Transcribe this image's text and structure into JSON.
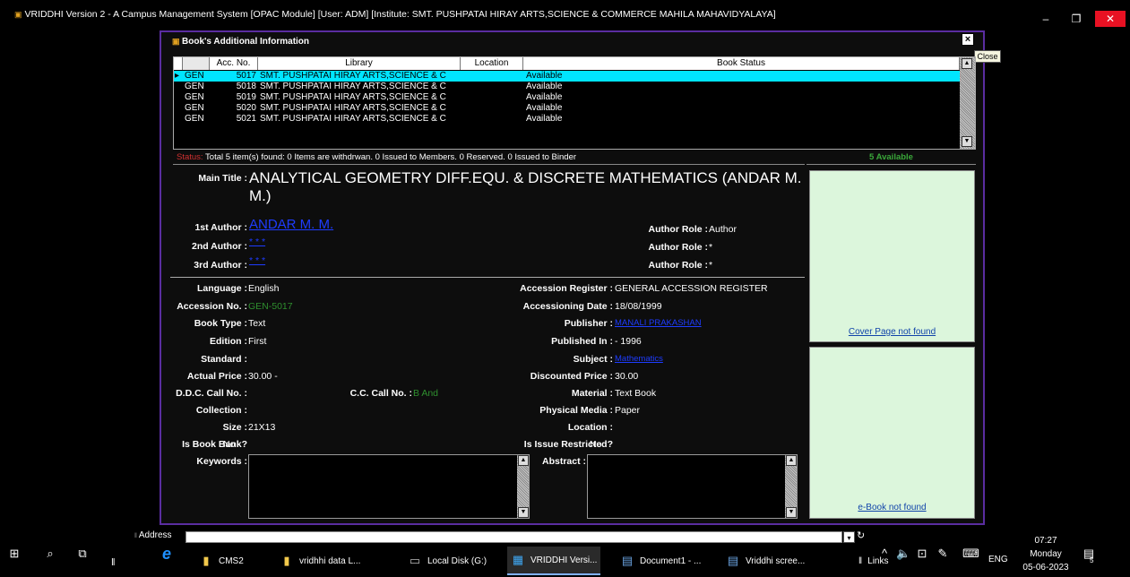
{
  "window": {
    "title": "VRIDDHI Version 2 - A Campus Management System [OPAC Module] [User: ADM] [Institute: SMT. PUSHPATAI HIRAY ARTS,SCIENCE & COMMERCE MAHILA MAHAVIDYALAYA]",
    "controls": {
      "minimize": "–",
      "restore": "❐",
      "close": "✕"
    }
  },
  "dialog": {
    "title": "Book's Additional Information",
    "close_glyph": "×",
    "close_tooltip": "Close"
  },
  "grid": {
    "columns": [
      "Acc. No.",
      "Library",
      "Location",
      "Book Status"
    ],
    "rows": [
      {
        "code": "GEN",
        "acc": "5017",
        "library": "SMT. PUSHPATAI HIRAY ARTS,SCIENCE & C",
        "location": "",
        "status": "Available",
        "selected": true
      },
      {
        "code": "GEN",
        "acc": "5018",
        "library": "SMT. PUSHPATAI HIRAY ARTS,SCIENCE & C",
        "location": "",
        "status": "Available"
      },
      {
        "code": "GEN",
        "acc": "5019",
        "library": "SMT. PUSHPATAI HIRAY ARTS,SCIENCE & C",
        "location": "",
        "status": "Available"
      },
      {
        "code": "GEN",
        "acc": "5020",
        "library": "SMT. PUSHPATAI HIRAY ARTS,SCIENCE & C",
        "location": "",
        "status": "Available"
      },
      {
        "code": "GEN",
        "acc": "5021",
        "library": "SMT. PUSHPATAI HIRAY ARTS,SCIENCE & C",
        "location": "",
        "status": "Available"
      }
    ]
  },
  "status": {
    "label": "Status:",
    "text": "Total 5 item(s) found:   0 Items are withdrwan.   0 Issued to Members.   0 Reserved.   0 Issued to Binder",
    "available": "5 Available"
  },
  "book": {
    "main_title_label": "Main Title :",
    "main_title": "ANALYTICAL GEOMETRY DIFF.EQU. & DISCRETE MATHEMATICS (ANDAR M. M.)",
    "author1_label": "1st Author :",
    "author1": "ANDAR M. M.",
    "author2_label": "2nd Author :",
    "author2": "* * *",
    "author3_label": "3rd Author :",
    "author3": "* * *",
    "role1_label": "Author Role :",
    "role1": "Author",
    "role2_label": "Author Role :",
    "role2": "*",
    "role3_label": "Author Role :",
    "role3": "*"
  },
  "details": {
    "language_label": "Language :",
    "language": "English",
    "accno_label": "Accession No. :",
    "accno": "GEN-5017",
    "booktype_label": "Book Type :",
    "booktype": "Text",
    "edition_label": "Edition :",
    "edition": "First",
    "standard_label": "Standard :",
    "standard": "",
    "price_label": "Actual Price :",
    "price": "30.00 -",
    "ddc_label": "D.D.C. Call No. :",
    "ddc": "",
    "cc_label": "C.C. Call No. :",
    "cc": "B And",
    "collection_label": "Collection :",
    "collection": "",
    "size_label": "Size :",
    "size": "21X13",
    "bookbank_label": "Is Book Bank?",
    "bookbank": "No",
    "keywords_label": "Keywords :",
    "register_label": "Accession Register :",
    "register": "GENERAL ACCESSION REGISTER",
    "accdate_label": "Accessioning Date :",
    "accdate": "18/08/1999",
    "publisher_label": "Publisher :",
    "publisher": "MANALI PRAKASHAN",
    "pubin_label": "Published In :",
    "pubin": "- 1996",
    "subject_label": "Subject :",
    "subject": "Mathematics",
    "discprice_label": "Discounted Price :",
    "discprice": "30.00",
    "material_label": "Material :",
    "material": "Text Book",
    "physical_label": "Physical Media :",
    "physical": "Paper",
    "location_label": "Location :",
    "location": "",
    "restricted_label": "Is Issue Restricted?",
    "restricted": "No",
    "abstract_label": "Abstract :"
  },
  "media": {
    "cover": "Cover Page not found",
    "ebook": "e-Book not found"
  },
  "taskbar": {
    "address_label": "Address",
    "links_label": "Links",
    "items": [
      "CMS2",
      "vridhhi data L...",
      "Local Disk (G:)",
      "VRIDDHI Versi...",
      "Document1 - ...",
      "Vriddhi scree..."
    ],
    "lang": "ENG",
    "time": "07:27",
    "day": "Monday",
    "date": "05-06-2023",
    "notif_count": "5"
  },
  "colors": {
    "dialog_border": "#5a2da0",
    "selected_row": "#00e5ff",
    "cover_bg": "#dcf6dc"
  }
}
